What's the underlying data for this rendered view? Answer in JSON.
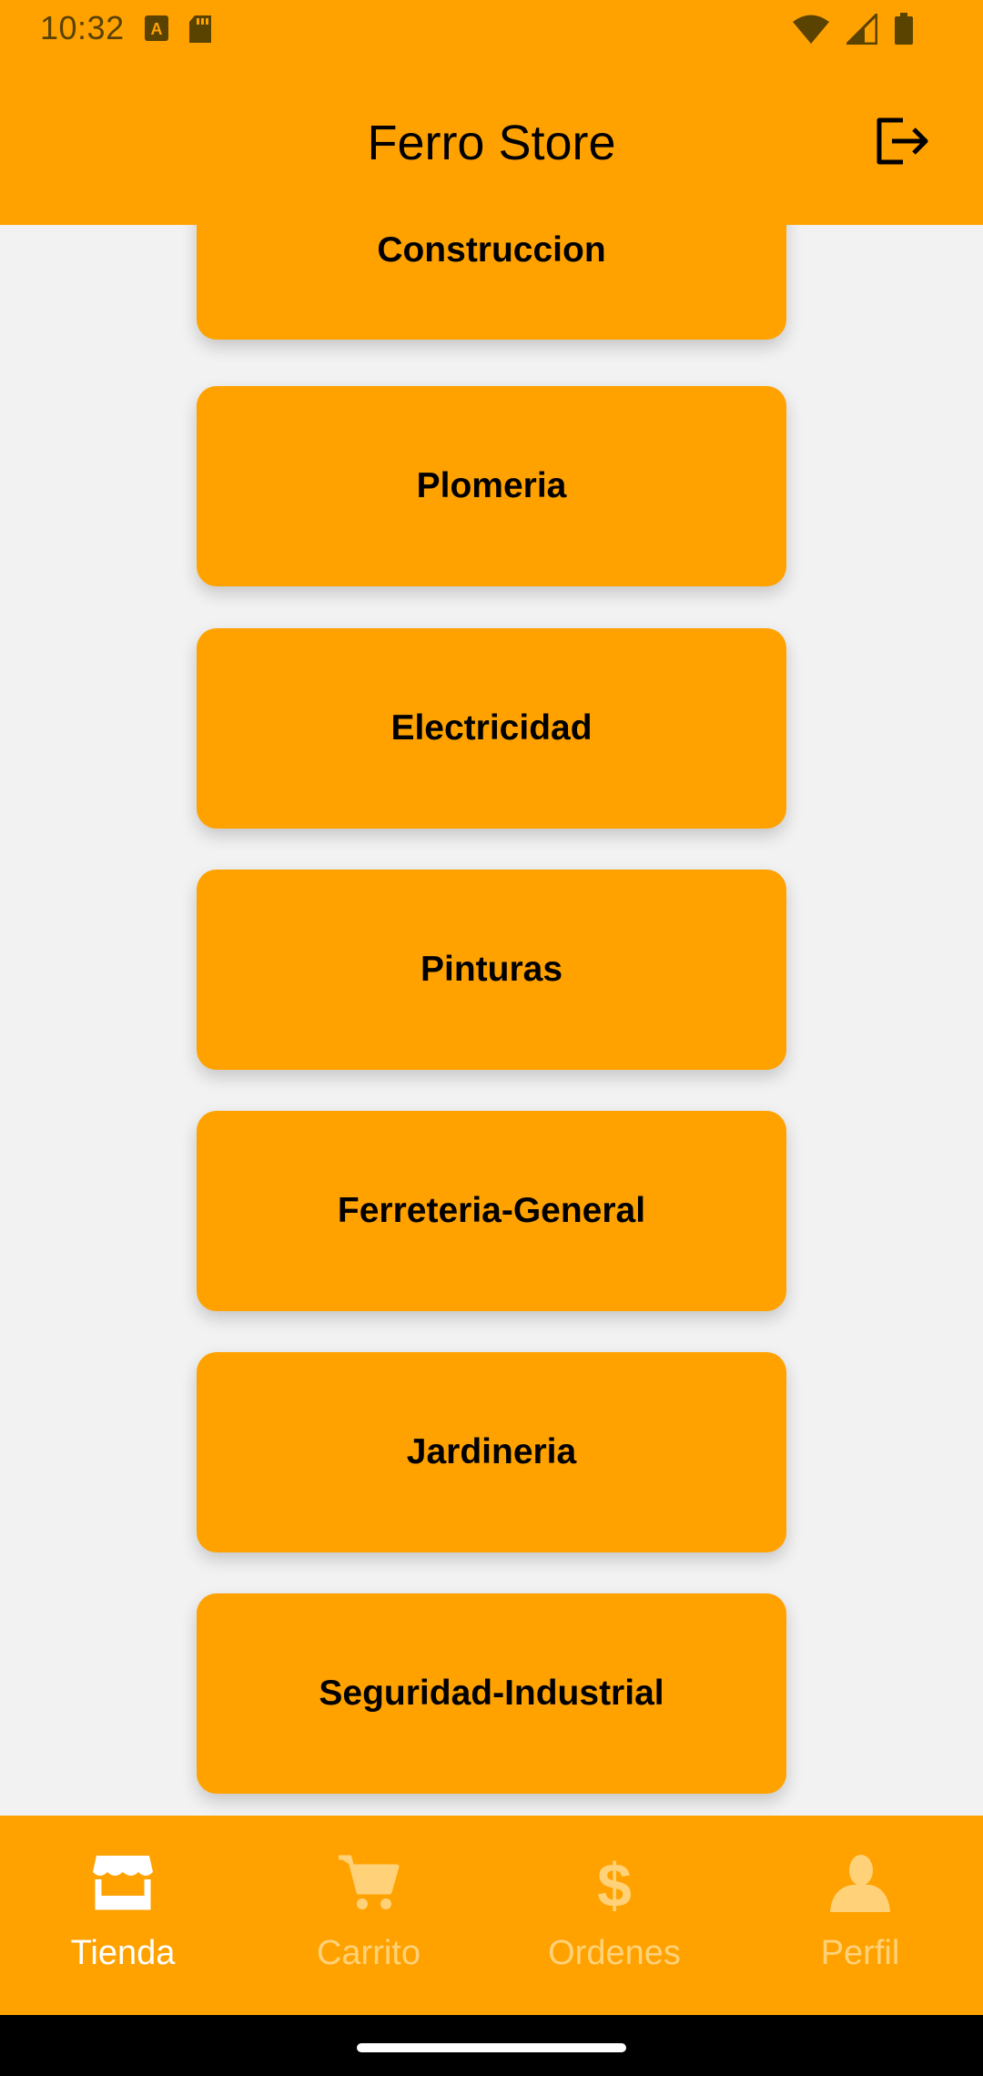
{
  "status_bar": {
    "time": "10:32",
    "left_icons": [
      "keyboard-a-icon",
      "sd-card-icon"
    ],
    "right_icons": [
      "wifi-icon",
      "signal-icon",
      "battery-icon"
    ]
  },
  "app_bar": {
    "title": "Ferro Store",
    "action_icon": "logout-icon"
  },
  "categories": [
    "Construccion",
    "Plomeria",
    "Electricidad",
    "Pinturas",
    "Ferreteria-General",
    "Jardineria",
    "Seguridad-Industrial"
  ],
  "bottom_nav": {
    "items": [
      {
        "label": "Tienda",
        "icon": "store-icon",
        "active": true
      },
      {
        "label": "Carrito",
        "icon": "cart-icon",
        "active": false
      },
      {
        "label": "Ordenes",
        "icon": "dollar-icon",
        "active": false
      },
      {
        "label": "Perfil",
        "icon": "person-icon",
        "active": false
      }
    ]
  },
  "colors": {
    "primary": "#ffa200",
    "background": "#f2f2f2",
    "active_nav": "#ffffff",
    "inactive_nav": "#ffd27a"
  }
}
